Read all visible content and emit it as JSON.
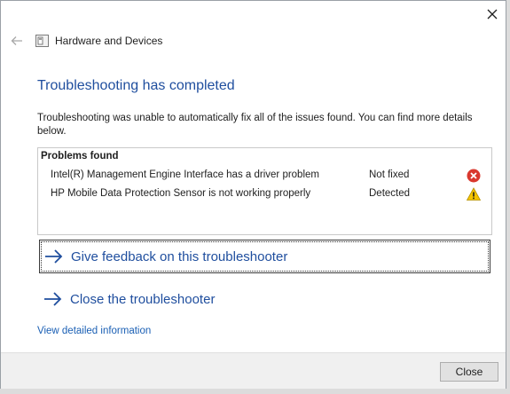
{
  "window": {
    "title": "Hardware and Devices",
    "close_glyph": "✕"
  },
  "main": {
    "heading": "Troubleshooting has completed",
    "description": "Troubleshooting was unable to automatically fix all of the issues found. You can find more details below."
  },
  "problems": {
    "header": "Problems found",
    "items": [
      {
        "name": "Intel(R) Management Engine Interface  has a driver problem",
        "status": "Not fixed",
        "icon": "error-icon"
      },
      {
        "name": "HP Mobile Data Protection Sensor is not working properly",
        "status": "Detected",
        "icon": "warning-icon"
      }
    ]
  },
  "links": {
    "feedback": "Give feedback on this troubleshooter",
    "close_troubleshooter": "Close the troubleshooter",
    "details": "View detailed information"
  },
  "footer": {
    "close_label": "Close"
  },
  "colors": {
    "heading_blue": "#1f4e9e",
    "link_blue": "#1a5fb4",
    "error_red": "#d9382e",
    "warning_yellow": "#f5c400"
  }
}
